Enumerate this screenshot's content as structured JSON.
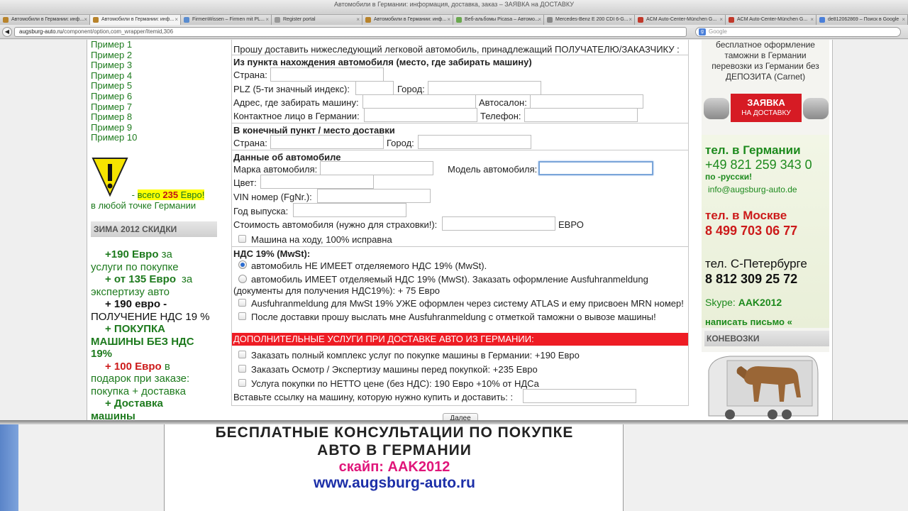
{
  "window": {
    "title": "Автомобили в Германии: информация, доставка, заказ – ЗАЯВКА на ДОСТАВКУ"
  },
  "tabs": [
    {
      "label": "Автомобили в Германии: инф..."
    },
    {
      "label": "Автомобили в Германии: инф..."
    },
    {
      "label": "FirmenWissen – Firmen mit PL..."
    },
    {
      "label": "Register portal"
    },
    {
      "label": "Автомобили в Германии: инф..."
    },
    {
      "label": "Веб-альбомы Picasa – Автомо..."
    },
    {
      "label": "Mercedes-Benz E 200 CDI 6-G..."
    },
    {
      "label": "ACM Auto-Center-München G..."
    },
    {
      "label": "ACM Auto-Center-München G..."
    },
    {
      "label": "de812062869 – Поиск в Google"
    }
  ],
  "nav": {
    "url_domain": "augsburg-auto.ru",
    "url_path": "/component/option,com_wrapper/Itemid,306",
    "search_placeholder": "Google"
  },
  "left": {
    "samples": [
      "Пример 1",
      "Пример 2",
      "Пример 3",
      "Пример 4",
      "Пример 5",
      "Пример 6",
      "Пример 7",
      "Пример 8",
      "Пример 9",
      "Пример 10"
    ],
    "warn_prefix": " - ",
    "warn_hl_pre": "всего ",
    "warn_hl_num": "235",
    "warn_hl_post": " Евро!",
    "warn_line2": "в любой точке Германии",
    "winter_title": "ЗИМА 2012 СКИДКИ",
    "promo": {
      "p1_a": "+190 Евро",
      "p1_b": " за",
      "p1_c": "услуги по покупке",
      "p2_a": "+ от 135 Евро",
      "p2_b": "за",
      "p2_c": "экспертизу  авто",
      "p3_a": "+ 190 евро",
      "p3_b": " -",
      "p3_c": "ПОЛУЧЕНИЕ  НДС  19 %",
      "p4_a": "+ ПОКУПКА",
      "p4_b": "МАШИНЫ  БЕЗ НДС",
      "p4_c": "19%",
      "p5_a": "+ 100 Евро",
      "p5_b": " в",
      "p5_c": "подарок при заказе:",
      "p5_d": "покупка + доставка",
      "p6_a": "+ Доставка",
      "p6_b": "машины"
    }
  },
  "form": {
    "intro": "Прошу доставить нижеследующий легковой автомобиль, принадлежащий ПОЛУЧАТЕЛЮ/ЗАКАЗЧИКУ :",
    "from_title": "Из пункта нахождения автомобиля (место, где забирать машину)",
    "country": "Страна:",
    "plz": "PLZ (5-ти значный индекс):",
    "city": "Город:",
    "address": "Адрес, где забирать машину:",
    "dealer": "Автосалон:",
    "contact": "Контактное лицо в Германии:",
    "phone": "Телефон:",
    "to_title": "В конечный пункт / место доставки",
    "car_title": "Данные об автомобиле",
    "brand": "Марка автомобиля:",
    "model": "Модель автомобиля:",
    "color": "Цвет:",
    "vin": "VIN номер (FgNr.):",
    "year": "Год выпуска:",
    "value": "Стоимость автомобиля (нужно для страховки!):",
    "currency": "ЕВРО",
    "running": "Машина на ходу, 100% исправна",
    "vat_title": "НДС 19% (MwSt):",
    "vat_opt1": "автомобиль НЕ ИМЕЕТ отделяемого НДС 19% (MwSt).",
    "vat_opt2a": "автомобиль ИМЕЕТ отделяемый НДС 19% (MwSt). Заказать оформление Ausfuhranmeldung",
    "vat_opt2b": "(документы для получения НДС19%): + 75 Евро",
    "vat_opt3": "Ausfuhranmeldung для MwSt 19% УЖЕ оформлен через систему ATLAS и ему присвоен MRN номер!",
    "vat_opt4": "После доставки прошу выслать мне Ausfuhranmeldung с отметкой таможни о вывозе машины!",
    "extras_title": "ДОПОЛНИТЕЛЬНЫЕ УСЛУГИ ПРИ ДОСТАВКЕ АВТО ИЗ ГЕРМАНИИ:",
    "extra1": "Заказать полный комплекс услуг по покупке машины в Германии: +190 Евро",
    "extra2": "Заказать Осмотр / Экспертизу машины перед покупкой: +235 Евро",
    "extra3": "Услуга покупки по НЕТТО цене (без НДС): 190 Евро +10% от НДСа",
    "link_label": "Вставьте ссылку на машину, которую нужно купить и доставить: :",
    "next": "Далее"
  },
  "right": {
    "customs_1": "бесплатное оформление",
    "customs_2": "таможни в Германии",
    "customs_3": "перевозки из Германии без",
    "customs_4": "ДЕПОЗИТА (Carnet)",
    "order_1": "ЗАЯВКА",
    "order_2": "НА ДОСТАВКУ",
    "de_title": "тел. в Германии",
    "de_phone": "+49 821 259 343 0",
    "de_note": "по -русски!",
    "email": "info@augsburg-auto.de",
    "msk_title": "тел. в Москве",
    "msk_phone": "8 499 703 06 77",
    "spb_title": "тел. С-Петербурге",
    "spb_phone": "8 812 309 25 72",
    "skype_label": "Skype: ",
    "skype_id": "AAK2012",
    "write": "написать письмо «",
    "horse_title": "КОНЕВОЗКИ"
  },
  "overlay": {
    "line1": "БЕСПЛАТНЫЕ  КОНСУЛЬТАЦИИ  ПО ПОКУПКЕ",
    "line2": "АВТО  В  ГЕРМАНИИ",
    "line3": "скайп:  AAK2012",
    "line4": "www.augsburg-auto.ru"
  }
}
